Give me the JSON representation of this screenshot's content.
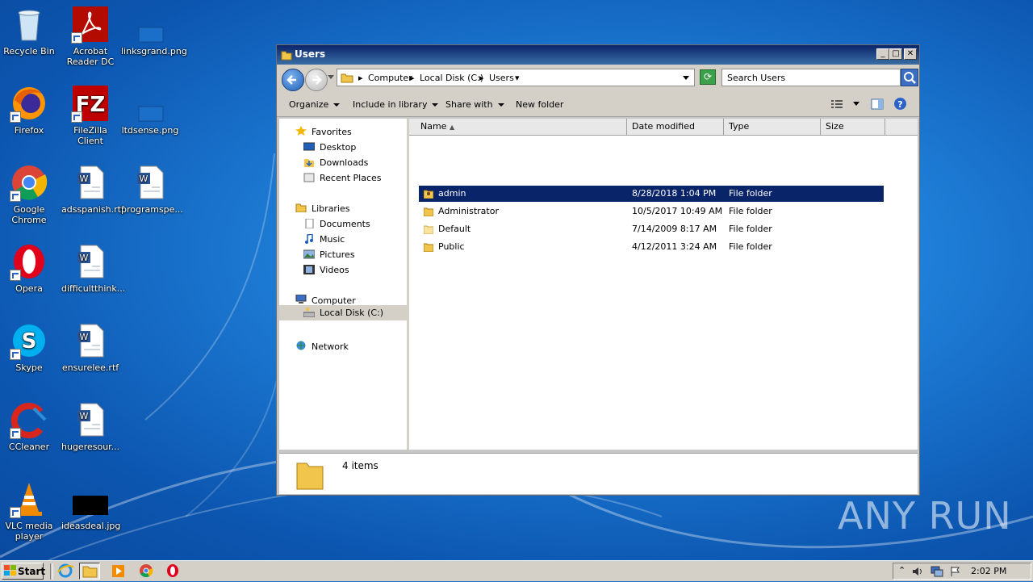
{
  "desktop": {
    "icons": [
      {
        "label": "Recycle Bin"
      },
      {
        "label": "Acrobat Reader DC"
      },
      {
        "label": "linksgrand.png"
      },
      {
        "label": "Firefox"
      },
      {
        "label": "FileZilla Client"
      },
      {
        "label": "ltdsense.png"
      },
      {
        "label": "Google Chrome"
      },
      {
        "label": "adsspanish.rtf"
      },
      {
        "label": "programspe..."
      },
      {
        "label": "Opera"
      },
      {
        "label": "difficultthink..."
      },
      {
        "label": "Skype"
      },
      {
        "label": "ensurelee.rtf"
      },
      {
        "label": "CCleaner"
      },
      {
        "label": "hugeresour..."
      },
      {
        "label": "VLC media player"
      },
      {
        "label": "ideasdeal.jpg"
      }
    ],
    "watermark": "ANY RUN"
  },
  "window": {
    "title": "Users",
    "breadcrumbs": [
      "Computer",
      "Local Disk (C:)",
      "Users"
    ],
    "search_placeholder": "Search Users",
    "toolbar": {
      "organize": "Organize",
      "include": "Include in library",
      "share": "Share with",
      "new_folder": "New folder"
    },
    "nav": {
      "favorites": "Favorites",
      "desktop": "Desktop",
      "downloads": "Downloads",
      "recent": "Recent Places",
      "libraries": "Libraries",
      "documents": "Documents",
      "music": "Music",
      "pictures": "Pictures",
      "videos": "Videos",
      "computer": "Computer",
      "local_disk": "Local Disk (C:)",
      "network": "Network"
    },
    "columns": {
      "name": "Name",
      "date": "Date modified",
      "type": "Type",
      "size": "Size"
    },
    "rows": [
      {
        "name": "admin",
        "date": "8/28/2018 1:04 PM",
        "type": "File folder"
      },
      {
        "name": "Administrator",
        "date": "10/5/2017 10:49 AM",
        "type": "File folder"
      },
      {
        "name": "Default",
        "date": "7/14/2009 8:17 AM",
        "type": "File folder"
      },
      {
        "name": "Public",
        "date": "4/12/2011 3:24 AM",
        "type": "File folder"
      }
    ],
    "status": "4 items"
  },
  "taskbar": {
    "start": "Start",
    "clock": "2:02 PM"
  }
}
